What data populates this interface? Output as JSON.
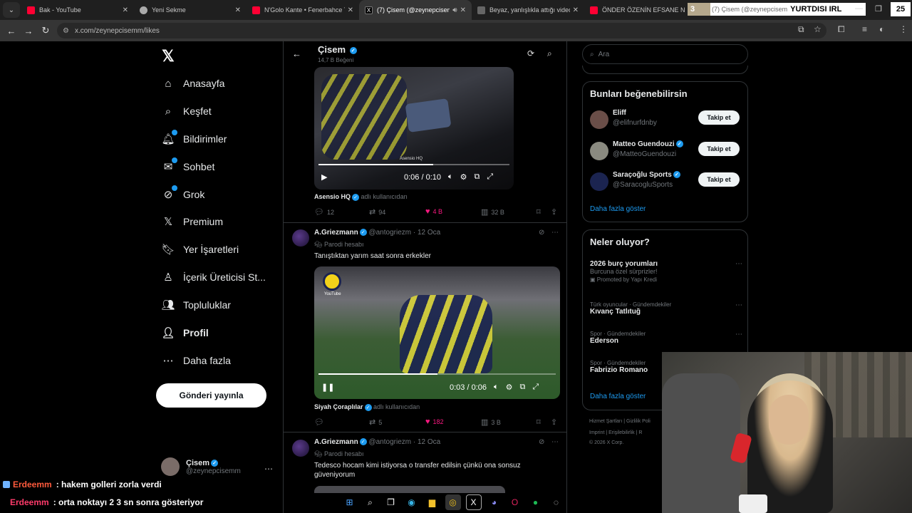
{
  "browser": {
    "tabs": [
      {
        "title": "Bak - YouTube",
        "icon": "youtube-icon"
      },
      {
        "title": "Yeni Sekme",
        "icon": "chrome-icon"
      },
      {
        "title": "N'Golo Kante • Fenerbahce Tra",
        "icon": "youtube-icon"
      },
      {
        "title": "(7) Çisem (@zeynepcisemm)",
        "icon": "x-icon"
      },
      {
        "title": "Beyaz, yanlışlıkla attığı videoyu",
        "icon": "youtube-icon"
      },
      {
        "title": "ÖNDER ÖZENİN EFSANE NGOL",
        "icon": "youtube-icon"
      }
    ],
    "overlay_title": {
      "num": "3",
      "tab": "(7) Çisem (@zeynepcisem",
      "text": "YURTDISI IRL"
    },
    "tab_counter": "25",
    "url": "x.com/zeynepcisemm/likes"
  },
  "nav": {
    "items": [
      {
        "label": "Anasayfa",
        "icon": "home-icon",
        "glyph": "⌂"
      },
      {
        "label": "Keşfet",
        "icon": "search-icon",
        "glyph": "⌕"
      },
      {
        "label": "Bildirimler",
        "icon": "bell-icon",
        "glyph": "🔔︎"
      },
      {
        "label": "Sohbet",
        "icon": "mail-icon",
        "glyph": "✉"
      },
      {
        "label": "Grok",
        "icon": "grok-icon",
        "glyph": "⊘"
      },
      {
        "label": "Premium",
        "icon": "x-logo-icon",
        "glyph": "𝕏"
      },
      {
        "label": "Yer İşaretleri",
        "icon": "bookmark-icon",
        "glyph": "🔖︎"
      },
      {
        "label": "İçerik Üreticisi St...",
        "icon": "creator-studio-icon",
        "glyph": "♙"
      },
      {
        "label": "Topluluklar",
        "icon": "communities-icon",
        "glyph": "👥︎"
      },
      {
        "label": "Profil",
        "icon": "profile-icon",
        "glyph": "👤︎"
      },
      {
        "label": "Daha fazla",
        "icon": "more-icon",
        "glyph": "⋯"
      }
    ],
    "post_button": "Gönderi yayınla",
    "account": {
      "name": "Çisem",
      "handle": "@zeynepcisemm"
    }
  },
  "main": {
    "header": {
      "name": "Çisem",
      "count": "14,7 B Beğeni"
    },
    "post1": {
      "video": {
        "time": "0:06 / 0:10",
        "progress": 0.6,
        "watermark": "Asensio HQ"
      },
      "source": {
        "name": "Asensio HQ",
        "suffix": "adlı kullanıcıdan"
      },
      "actions": {
        "replies": "12",
        "reposts": "94",
        "likes": "4 B",
        "views": "32 B"
      }
    },
    "post2": {
      "name": "A.Griezmann",
      "handle": "@antogriezm",
      "date": "· 12 Oca",
      "parody": "Parodi hesabı",
      "text": "Tanıştıktan yarım saat sonra erkekler",
      "video": {
        "time": "0:03 / 0:06",
        "progress": 0.5,
        "yt": "YouTube"
      },
      "source": {
        "name": "Siyah Çoraplılar",
        "suffix": "adlı kullanıcıdan"
      },
      "actions": {
        "replies": "",
        "reposts": "5",
        "likes": "182",
        "views": "3 B"
      }
    },
    "post3": {
      "name": "A.Griezmann",
      "handle": "@antogriezm",
      "date": "· 12 Oca",
      "parody": "Parodi hesabı",
      "text": "Tedesco hocam kimi istiyorsa o transfer edilsin çünkü ona sonsuz güveniyorum"
    }
  },
  "right": {
    "search_placeholder": "Ara",
    "suggest": {
      "title": "Bunları beğenebilirsin",
      "users": [
        {
          "name": "Eliff",
          "handle": "@elifnurfdnby",
          "verified": false,
          "avatar": "#6a4e48"
        },
        {
          "name": "Matteo Guendouzi",
          "handle": "@MatteoGuendouzi",
          "verified": true,
          "avatar": "#8a8a80"
        },
        {
          "name": "Saraçoğlu Sports",
          "handle": "@SaracogluSports",
          "verified": true,
          "avatar": "#1b2450"
        }
      ],
      "follow": "Takip et",
      "more": "Daha fazla göster"
    },
    "trends": {
      "title": "Neler oluyor?",
      "items": [
        {
          "category": "",
          "title": "2026 burç yorumları",
          "sub": "Burcuna özel sürprizler!",
          "promo": "Promoted by Yapı Kredi"
        },
        {
          "category": "Türk oyuncular · Gündemdekiler",
          "title": "Kıvanç Tatlıtuğ",
          "sub": "",
          "promo": ""
        },
        {
          "category": "Spor · Gündemdekiler",
          "title": "Ederson",
          "sub": "",
          "promo": ""
        },
        {
          "category": "Spor · Gündemdekiler",
          "title": "Fabrizio Romano",
          "sub": "",
          "promo": ""
        }
      ],
      "more": "Daha fazla göster"
    },
    "footer": {
      "line1": "Hizmet Şartları  |  Gizlilik Poli",
      "line2": "Imprint  |  Erişilebilirlik  |  R",
      "line3": "© 2026 X Corp."
    }
  },
  "chat": [
    {
      "user": "Erdeemm",
      "message": ": hakem golleri zorla verdi"
    },
    {
      "user": "Erdeemm",
      "message": ": orta noktayı 2 3 sn sonra gösteriyor"
    }
  ],
  "colors": {
    "accent": "#1d9bf0",
    "like": "#f91880",
    "bg": "#000000",
    "border": "#2f3336"
  }
}
